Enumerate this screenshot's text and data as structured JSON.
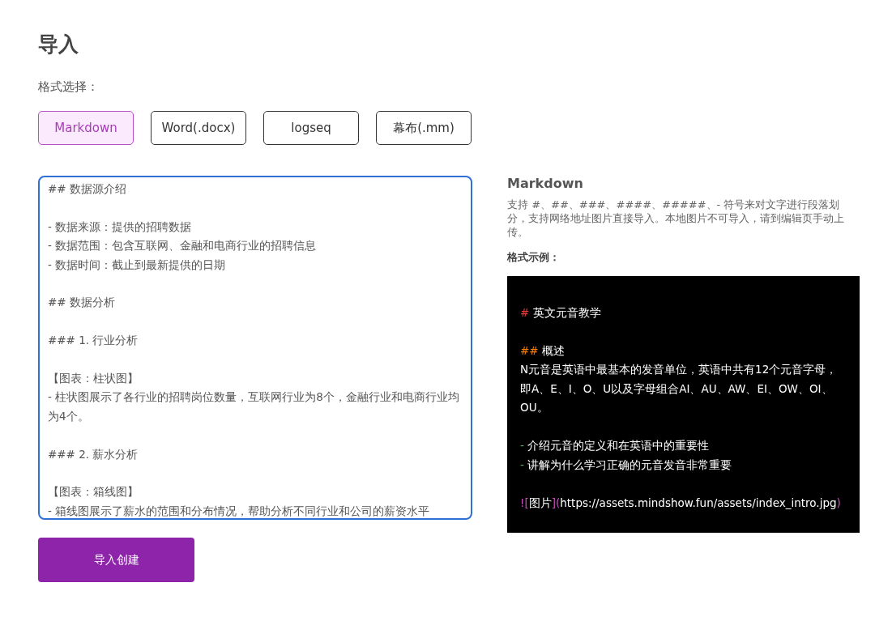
{
  "title": "导入",
  "format_label": "格式选择：",
  "formats": [
    {
      "label": "Markdown",
      "selected": true
    },
    {
      "label": "Word(.docx)",
      "selected": false
    },
    {
      "label": "logseq",
      "selected": false
    },
    {
      "label": "幕布(.mm)",
      "selected": false
    }
  ],
  "editor": {
    "lines": [
      {
        "kind": "text",
        "text": "## 数据源介绍"
      },
      {
        "kind": "blank"
      },
      {
        "kind": "text",
        "text": "- 数据来源：提供的招聘数据"
      },
      {
        "kind": "text",
        "text": "- 数据范围：包含互联网、金融和电商行业的招聘信息"
      },
      {
        "kind": "text",
        "text": "- 数据时间：截止到最新提供的日期"
      },
      {
        "kind": "blank"
      },
      {
        "kind": "text",
        "text": "## 数据分析"
      },
      {
        "kind": "blank"
      },
      {
        "kind": "text",
        "text": "### 1. 行业分析"
      },
      {
        "kind": "blank"
      },
      {
        "kind": "text",
        "text": "【图表：柱状图】"
      },
      {
        "kind": "text",
        "text": "- 柱状图展示了各行业的招聘岗位数量，互联网行业为8个，金融行业和电商行业均为4个。"
      },
      {
        "kind": "blank"
      },
      {
        "kind": "text",
        "text": "### 2. 薪水分析"
      },
      {
        "kind": "blank"
      },
      {
        "kind": "text",
        "text": "【图表：箱线图】"
      },
      {
        "kind": "text",
        "text": "- 箱线图展示了薪水的范围和分布情况，帮助分析不同行业和公司的薪资水平"
      }
    ]
  },
  "submit_button": "导入创建",
  "help": {
    "heading": "Markdown",
    "description": "支持 #、##、###、####、#####、- 符号来对文字进行段落划分，支持网络地址图片直接导入。本地图片不可导入，请到编辑页手动上传。",
    "example_label": "格式示例："
  },
  "example": [
    {
      "kind": "blank"
    },
    {
      "kind": "line",
      "segments": [
        {
          "text": "#",
          "color": "#e53935"
        },
        {
          "text": " 英文元音教学"
        }
      ]
    },
    {
      "kind": "blank"
    },
    {
      "kind": "line",
      "segments": [
        {
          "text": "##",
          "color": "#f57c00"
        },
        {
          "text": " 概述"
        }
      ]
    },
    {
      "kind": "line",
      "segments": [
        {
          "text": " N元音是英语中最基本的发音单位，英语中共有12个元音字母，即A、E、I、O、U以及字母组合AI、AU、AW、EI、OW、OI、OU。"
        }
      ]
    },
    {
      "kind": "blank"
    },
    {
      "kind": "line",
      "segments": [
        {
          "text": "-",
          "color": "#4caf50"
        },
        {
          "text": " 介绍元音的定义和在英语中的重要性"
        }
      ]
    },
    {
      "kind": "line",
      "segments": [
        {
          "text": "-",
          "color": "#4caf50"
        },
        {
          "text": " 讲解为什么学习正确的元音发音非常重要"
        }
      ]
    },
    {
      "kind": "blank"
    },
    {
      "kind": "line",
      "segments": [
        {
          "text": "![",
          "color": "#c850c0"
        },
        {
          "text": "图片"
        },
        {
          "text": "](",
          "color": "#c850c0"
        },
        {
          "text": "https://assets.mindshow.fun/assets/index_intro.jpg"
        },
        {
          "text": ")",
          "color": "#c850c0"
        }
      ]
    },
    {
      "kind": "blank"
    }
  ]
}
